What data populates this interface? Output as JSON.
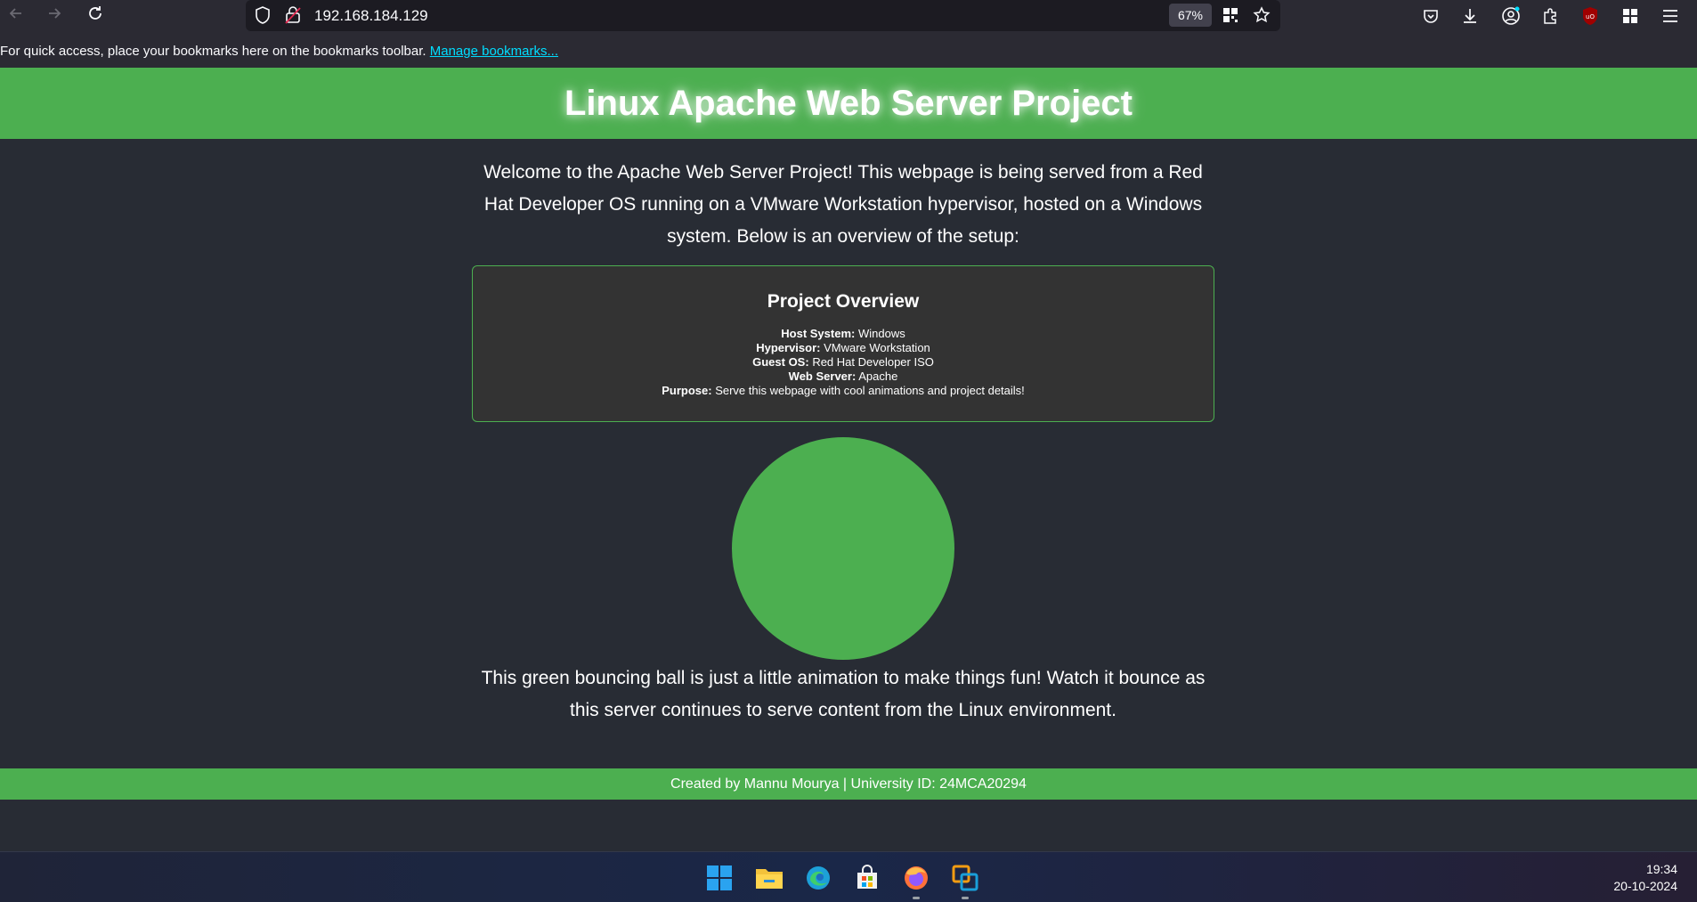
{
  "browser": {
    "url": "192.168.184.129",
    "zoom": "67%",
    "bookmarks_message": "For quick access, place your bookmarks here on the bookmarks toolbar.",
    "bookmarks_link": "Manage bookmarks..."
  },
  "page": {
    "title": "Linux Apache Web Server Project",
    "intro": "Welcome to the Apache Web Server Project! This webpage is being served from a Red Hat Developer OS running on a VMware Workstation hypervisor, hosted on a Windows system. Below is an overview of the setup:",
    "overview": {
      "heading": "Project Overview",
      "rows": [
        {
          "label": "Host System:",
          "value": "Windows"
        },
        {
          "label": "Hypervisor:",
          "value": "VMware Workstation"
        },
        {
          "label": "Guest OS:",
          "value": "Red Hat Developer ISO"
        },
        {
          "label": "Web Server:",
          "value": "Apache"
        },
        {
          "label": "Purpose:",
          "value": "Serve this webpage with cool animations and project details!"
        }
      ]
    },
    "outro": "This green bouncing ball is just a little animation to make things fun! Watch it bounce as this server continues to serve content from the Linux environment.",
    "footer": "Created by Mannu Mourya | University ID: 24MCA20294",
    "accent_color": "#4caf50"
  },
  "taskbar": {
    "time": "19:34",
    "date": "20-10-2024",
    "apps": [
      "windows-start-icon",
      "file-explorer-icon",
      "edge-icon",
      "store-icon",
      "firefox-icon",
      "vmware-icon"
    ]
  }
}
